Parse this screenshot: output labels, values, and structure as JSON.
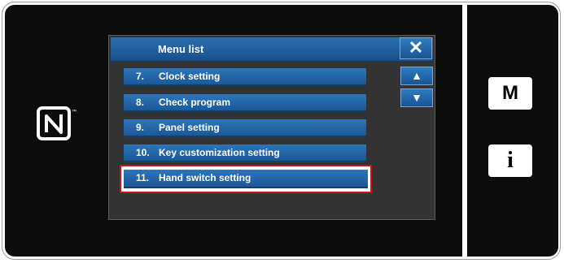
{
  "menu": {
    "title": "Menu list",
    "close_glyph": "✕",
    "items": [
      {
        "number": "7.",
        "label": "Clock setting"
      },
      {
        "number": "8.",
        "label": "Check program"
      },
      {
        "number": "9.",
        "label": "Panel setting"
      },
      {
        "number": "10.",
        "label": "Key customization setting"
      },
      {
        "number": "11.",
        "label": "Hand switch setting"
      }
    ],
    "highlighted_item": "11. Hand switch setting",
    "scroll_up_glyph": "▲",
    "scroll_down_glyph": "▼"
  },
  "side_buttons": {
    "mode_label": "M",
    "info_label": "i"
  },
  "icons": {
    "nfc": "nfc-icon"
  },
  "colors": {
    "accent": "#1f5fa0",
    "highlight_border": "#c8141e",
    "bezel": "#0c0c0c"
  }
}
